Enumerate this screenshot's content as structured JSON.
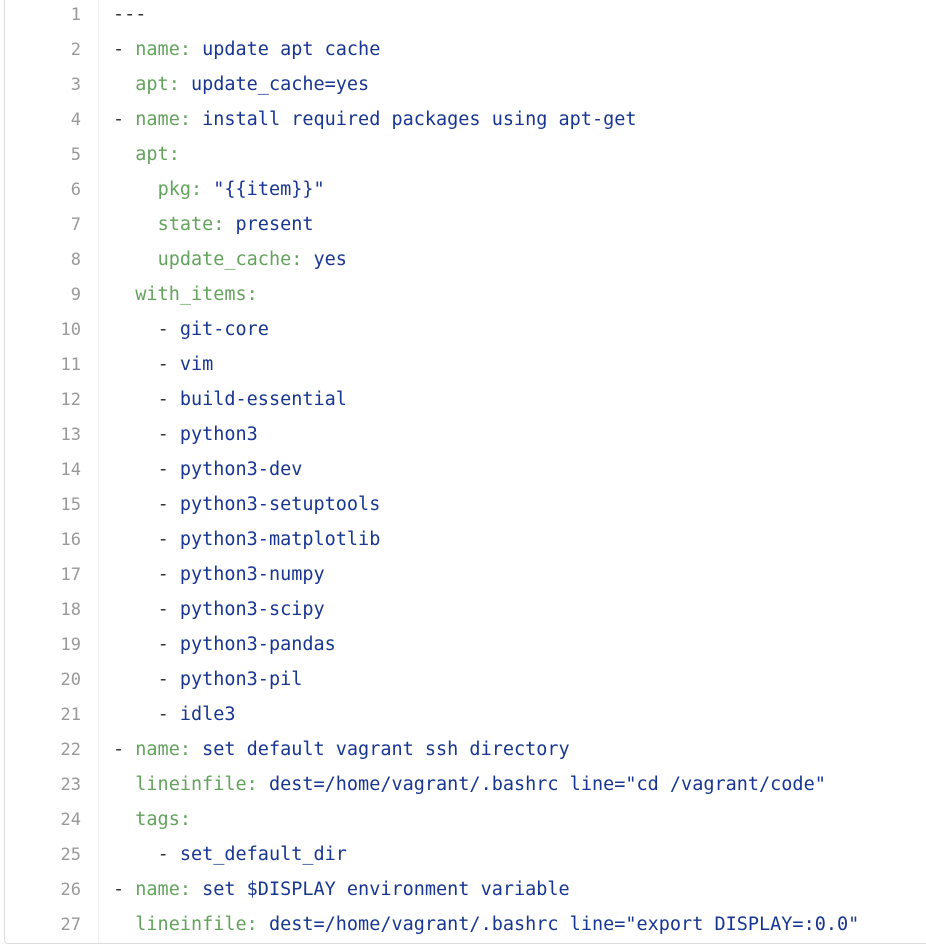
{
  "editor": {
    "colors": {
      "key": "#63a35c",
      "value": "#183691",
      "plain": "#333333",
      "line_number": "#999999"
    },
    "lines": [
      {
        "n": "1",
        "indent": "",
        "dash": "",
        "key": "",
        "value": "---"
      },
      {
        "n": "2",
        "indent": "",
        "dash": "- ",
        "key": "name:",
        "value": " update apt cache"
      },
      {
        "n": "3",
        "indent": "  ",
        "dash": "",
        "key": "apt:",
        "value": " update_cache=yes"
      },
      {
        "n": "4",
        "indent": "",
        "dash": "- ",
        "key": "name:",
        "value": " install required packages using apt-get"
      },
      {
        "n": "5",
        "indent": "  ",
        "dash": "",
        "key": "apt:",
        "value": ""
      },
      {
        "n": "6",
        "indent": "    ",
        "dash": "",
        "key": "pkg:",
        "value": " \"{{item}}\""
      },
      {
        "n": "7",
        "indent": "    ",
        "dash": "",
        "key": "state:",
        "value": " present"
      },
      {
        "n": "8",
        "indent": "    ",
        "dash": "",
        "key": "update_cache:",
        "value": " yes"
      },
      {
        "n": "9",
        "indent": "  ",
        "dash": "",
        "key": "with_items:",
        "value": ""
      },
      {
        "n": "10",
        "indent": "    ",
        "dash": "- ",
        "key": "",
        "value": "git-core"
      },
      {
        "n": "11",
        "indent": "    ",
        "dash": "- ",
        "key": "",
        "value": "vim"
      },
      {
        "n": "12",
        "indent": "    ",
        "dash": "- ",
        "key": "",
        "value": "build-essential"
      },
      {
        "n": "13",
        "indent": "    ",
        "dash": "- ",
        "key": "",
        "value": "python3"
      },
      {
        "n": "14",
        "indent": "    ",
        "dash": "- ",
        "key": "",
        "value": "python3-dev"
      },
      {
        "n": "15",
        "indent": "    ",
        "dash": "- ",
        "key": "",
        "value": "python3-setuptools"
      },
      {
        "n": "16",
        "indent": "    ",
        "dash": "- ",
        "key": "",
        "value": "python3-matplotlib"
      },
      {
        "n": "17",
        "indent": "    ",
        "dash": "- ",
        "key": "",
        "value": "python3-numpy"
      },
      {
        "n": "18",
        "indent": "    ",
        "dash": "- ",
        "key": "",
        "value": "python3-scipy"
      },
      {
        "n": "19",
        "indent": "    ",
        "dash": "- ",
        "key": "",
        "value": "python3-pandas"
      },
      {
        "n": "20",
        "indent": "    ",
        "dash": "- ",
        "key": "",
        "value": "python3-pil"
      },
      {
        "n": "21",
        "indent": "    ",
        "dash": "- ",
        "key": "",
        "value": "idle3"
      },
      {
        "n": "22",
        "indent": "",
        "dash": "- ",
        "key": "name:",
        "value": " set default vagrant ssh directory"
      },
      {
        "n": "23",
        "indent": "  ",
        "dash": "",
        "key": "lineinfile:",
        "value": " dest=/home/vagrant/.bashrc line=\"cd /vagrant/code\""
      },
      {
        "n": "24",
        "indent": "  ",
        "dash": "",
        "key": "tags:",
        "value": ""
      },
      {
        "n": "25",
        "indent": "    ",
        "dash": "- ",
        "key": "",
        "value": "set_default_dir"
      },
      {
        "n": "26",
        "indent": "",
        "dash": "- ",
        "key": "name:",
        "value": " set $DISPLAY environment variable"
      },
      {
        "n": "27",
        "indent": "  ",
        "dash": "",
        "key": "lineinfile:",
        "value": " dest=/home/vagrant/.bashrc line=\"export DISPLAY=:0.0\""
      }
    ]
  }
}
